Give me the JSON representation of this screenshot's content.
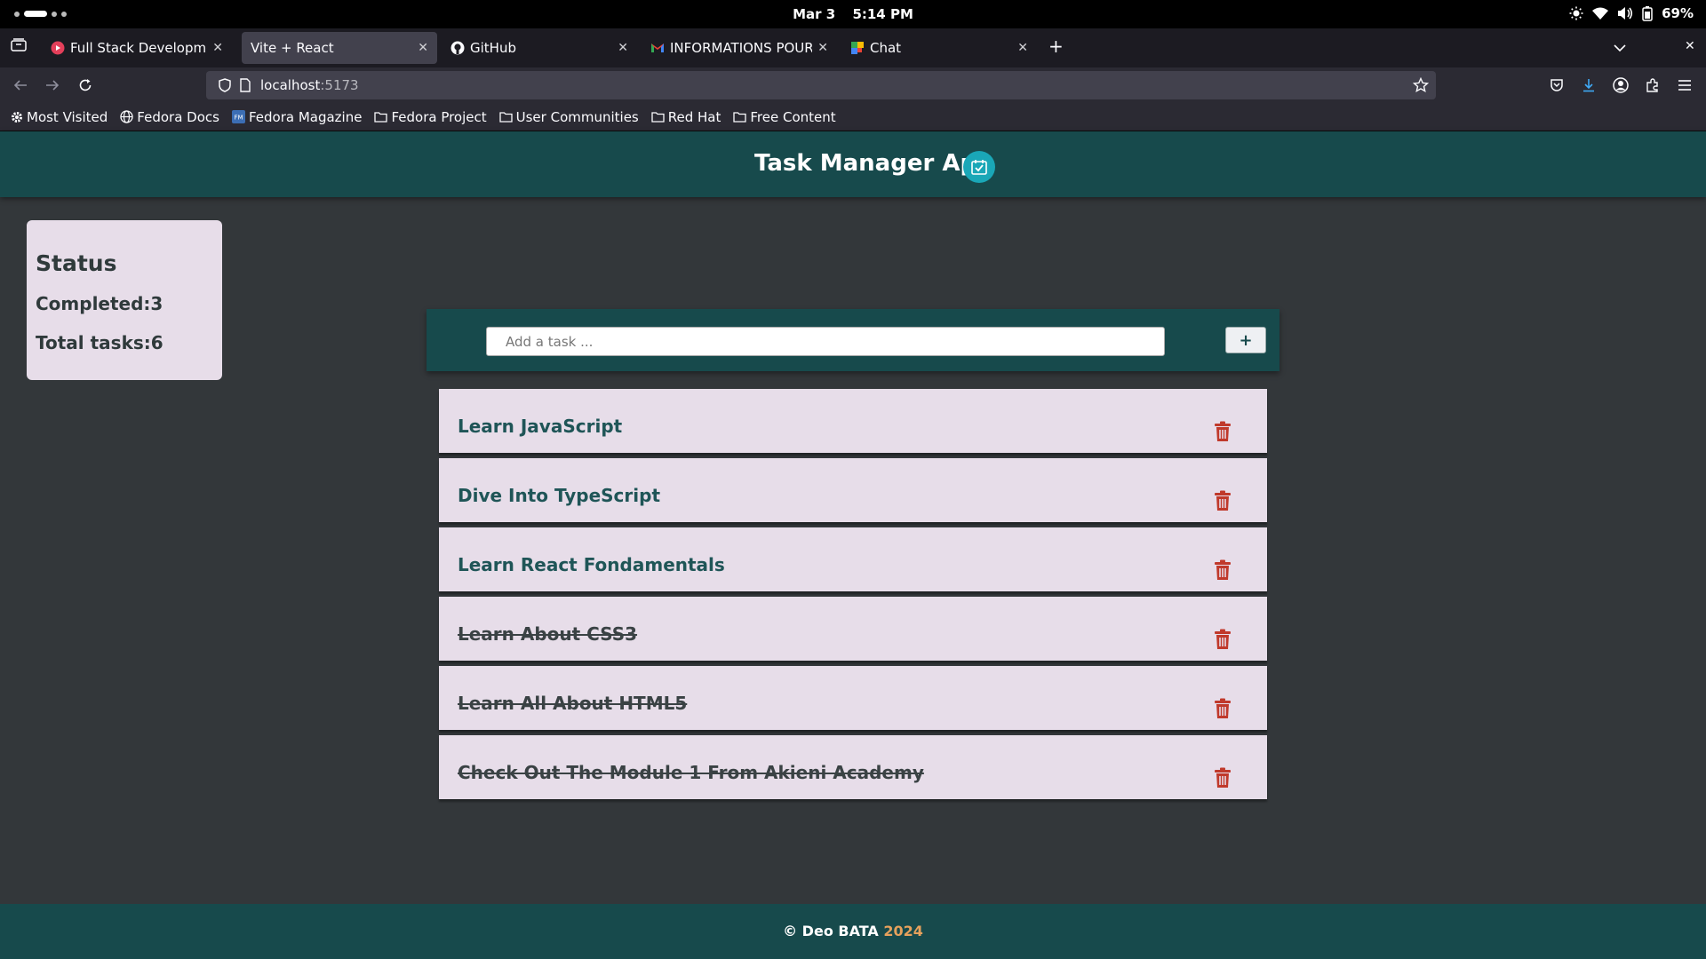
{
  "system": {
    "date": "Mar 3",
    "time": "5:14 PM",
    "battery": "69%"
  },
  "browser": {
    "tabs": [
      {
        "label": "Full Stack Development S",
        "active": false
      },
      {
        "label": "Vite + React",
        "active": true
      },
      {
        "label": "GitHub",
        "active": false
      },
      {
        "label": "INFORMATIONS POUR LE",
        "active": false
      },
      {
        "label": "Chat",
        "active": false
      }
    ],
    "url": {
      "host": "localhost",
      "port": ":5173"
    },
    "bookmarks": [
      {
        "label": "Most Visited",
        "icon": "gear-icon"
      },
      {
        "label": "Fedora Docs",
        "icon": "globe-icon"
      },
      {
        "label": "Fedora Magazine",
        "icon": "fm-icon"
      },
      {
        "label": "Fedora Project",
        "icon": "folder-icon"
      },
      {
        "label": "User Communities",
        "icon": "folder-icon"
      },
      {
        "label": "Red Hat",
        "icon": "folder-icon"
      },
      {
        "label": "Free Content",
        "icon": "folder-icon"
      }
    ]
  },
  "app": {
    "title": "Task Manager App",
    "status": {
      "title": "Status",
      "completed": "Completed:3",
      "total": "Total tasks:6"
    },
    "input": {
      "placeholder": "Add a task ...",
      "add_label": "+"
    },
    "tasks": [
      {
        "text": "Learn JavaScript",
        "completed": false
      },
      {
        "text": "Dive Into TypeScript",
        "completed": false
      },
      {
        "text": "Learn React Fondamentals",
        "completed": false
      },
      {
        "text": "Learn About CSS3",
        "completed": true
      },
      {
        "text": "Learn All About HTML5",
        "completed": true
      },
      {
        "text": "Check Out The Module 1 From Akieni Academy",
        "completed": true
      }
    ],
    "footer": {
      "copyright": "© Deo BATA",
      "year": "2024"
    }
  },
  "colors": {
    "header": "#174a4c",
    "card": "#e7dde9",
    "background": "#33373a",
    "trash": "#c0392b",
    "year": "#e6a15c"
  }
}
